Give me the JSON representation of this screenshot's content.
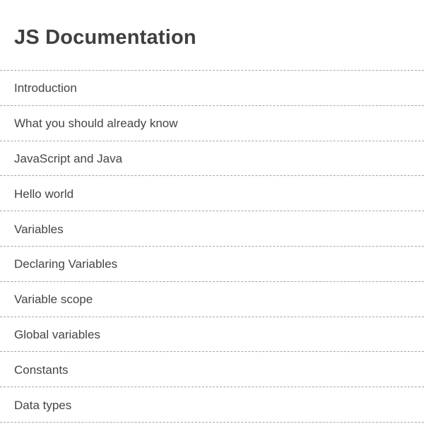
{
  "header": {
    "title": "JS Documentation"
  },
  "nav": {
    "items": [
      {
        "label": "Introduction"
      },
      {
        "label": "What you should already know"
      },
      {
        "label": "JavaScript and Java"
      },
      {
        "label": "Hello world"
      },
      {
        "label": "Variables"
      },
      {
        "label": "Declaring Variables"
      },
      {
        "label": "Variable scope"
      },
      {
        "label": "Global variables"
      },
      {
        "label": "Constants"
      },
      {
        "label": "Data types"
      }
    ]
  }
}
